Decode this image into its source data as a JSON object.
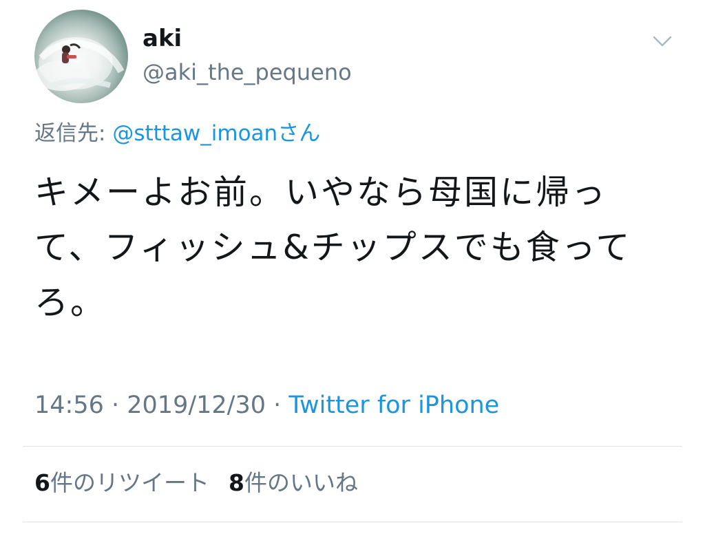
{
  "tweet": {
    "user": {
      "display_name": "aki",
      "handle": "@aki_the_pequeno"
    },
    "reply_to": {
      "prefix": "返信先: ",
      "mention": "@stttaw_imoan",
      "suffix": "さん"
    },
    "text": "キメーよお前。いやなら母国に帰っ\nて、フィッシュ&チップスでも食って\nろ。",
    "meta": {
      "time": "14:56",
      "sep1": " · ",
      "date": "2019/12/30",
      "sep2": " · ",
      "source": "Twitter for iPhone"
    },
    "stats": {
      "retweet_count": "6",
      "retweet_label": "件のリツイート",
      "like_count": "8",
      "like_label": "件のいいね"
    }
  },
  "icons": {
    "avatar": "profile-photo-surfer",
    "menu": "chevron-down-icon"
  },
  "colors": {
    "text_primary": "#14171a",
    "text_secondary": "#657786",
    "link": "#1b95e0",
    "divider": "#dfe3e6"
  }
}
